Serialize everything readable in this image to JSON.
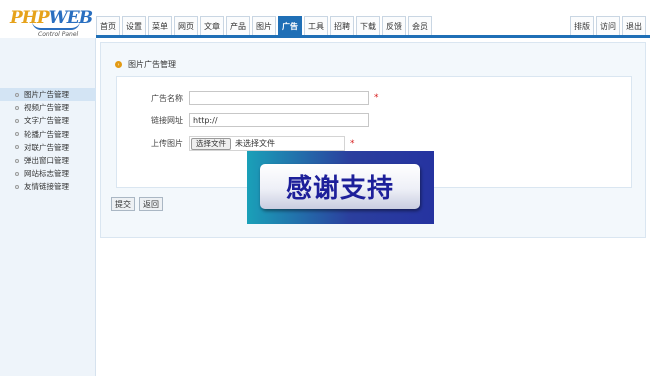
{
  "logo": {
    "main": "PHP",
    "accent": "WEB",
    "subtitle": "Control Panel"
  },
  "nav": {
    "tabs": [
      "首页",
      "设置",
      "菜单",
      "网页",
      "文章",
      "产品",
      "图片",
      "广告",
      "工具",
      "招聘",
      "下载",
      "反馈",
      "会员"
    ],
    "active_tab": "广告",
    "right_tabs": [
      "排版",
      "访问",
      "退出"
    ]
  },
  "sidebar": {
    "items": [
      "图片广告管理",
      "视频广告管理",
      "文字广告管理",
      "轮播广告管理",
      "对联广告管理",
      "弹出窗口管理",
      "网站标志管理",
      "友情链接管理"
    ],
    "active_item": "图片广告管理"
  },
  "panel": {
    "title": "图片广告管理"
  },
  "form": {
    "name_label": "广告名称",
    "name_value": "",
    "link_label": "链接网址",
    "link_value": "http://",
    "upload_label": "上传图片",
    "file_button": "选择文件",
    "file_status": "未选择文件",
    "required_mark": "*"
  },
  "actions": {
    "submit": "提交",
    "back": "返回"
  },
  "overlay": {
    "text": "感谢支持"
  },
  "colors": {
    "accent": "#1f6fb6",
    "required": "#d71c1c",
    "sidebar_bg": "#eef4fa"
  }
}
